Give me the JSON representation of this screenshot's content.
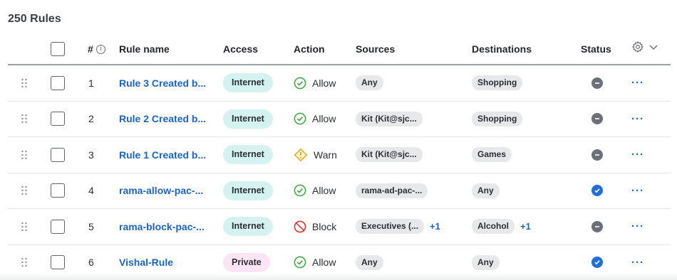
{
  "count_label": "250 Rules",
  "columns": {
    "num": "#",
    "name": "Rule name",
    "access": "Access",
    "action": "Action",
    "sources": "Sources",
    "destinations": "Destinations",
    "status": "Status"
  },
  "rows": [
    {
      "num": "1",
      "name": "Rule 3 Created b...",
      "access": "Internet",
      "action": "Allow",
      "action_icon": "check-circle-icon",
      "source": "Any",
      "source_more": "",
      "destination": "Shopping",
      "destination_more": "",
      "status": "disabled",
      "more": "···"
    },
    {
      "num": "2",
      "name": "Rule 2 Created b...",
      "access": "Internet",
      "action": "Allow",
      "action_icon": "check-circle-icon",
      "source": "Kit (Kit@sjc...",
      "source_more": "",
      "destination": "Shopping",
      "destination_more": "",
      "status": "disabled",
      "more": "···"
    },
    {
      "num": "3",
      "name": "Rule 1 Created b...",
      "access": "Internet",
      "action": "Warn",
      "action_icon": "warning-icon",
      "source": "Kit (Kit@sjc...",
      "source_more": "",
      "destination": "Games",
      "destination_more": "",
      "status": "disabled",
      "more": "···"
    },
    {
      "num": "4",
      "name": "rama-allow-pac-...",
      "access": "Internet",
      "action": "Allow",
      "action_icon": "check-circle-icon",
      "source": "rama-ad-pac-...",
      "source_more": "",
      "destination": "Any",
      "destination_more": "",
      "status": "enabled",
      "more": "···"
    },
    {
      "num": "5",
      "name": "rama-block-pac-...",
      "access": "Internet",
      "action": "Block",
      "action_icon": "block-icon",
      "source": "Executives (...",
      "source_more": "+1",
      "destination": "Alcohol",
      "destination_more": "+1",
      "status": "disabled",
      "more": "···"
    },
    {
      "num": "6",
      "name": "Vishal-Rule",
      "access": "Private",
      "action": "Allow",
      "action_icon": "check-circle-icon",
      "source": "Any",
      "source_more": "",
      "destination": "Any",
      "destination_more": "",
      "status": "enabled",
      "more": "···"
    }
  ],
  "colors": {
    "link": "#1a64c8",
    "internet_pill": "#d3f2f0",
    "private_pill": "#fde4f4",
    "status_enabled": "#1e6fd9",
    "status_disabled": "#6b7079",
    "allow": "#3aa33a",
    "warn": "#e6a817",
    "block": "#d9342b"
  }
}
